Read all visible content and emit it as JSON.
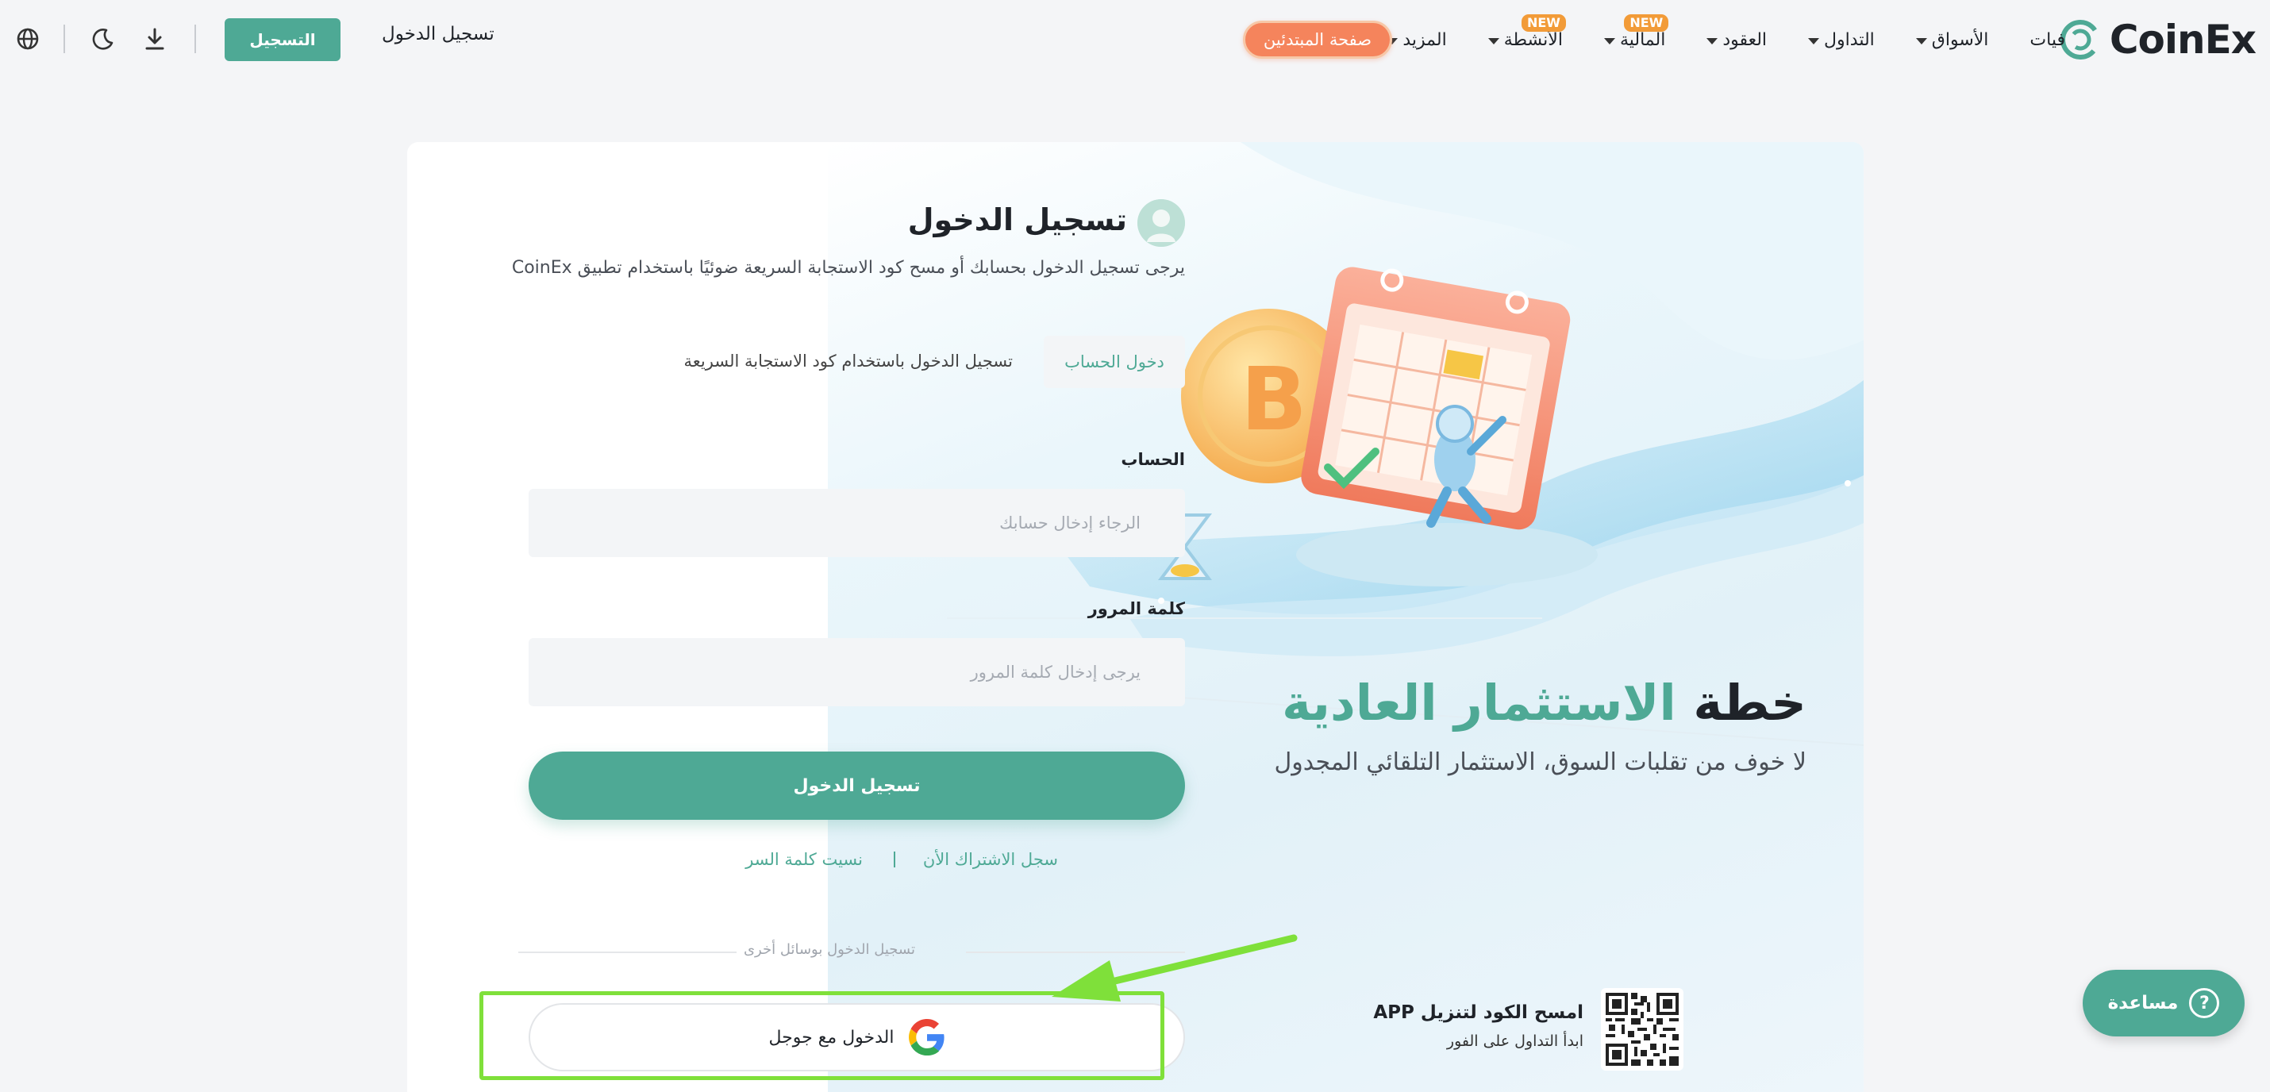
{
  "brand": {
    "name": "CoinEx",
    "color": "#4ea995"
  },
  "nav": {
    "items": [
      {
        "label": "فيات",
        "caret": false,
        "badge": ""
      },
      {
        "label": "الأسواق",
        "caret": true,
        "badge": ""
      },
      {
        "label": "التداول",
        "caret": true,
        "badge": ""
      },
      {
        "label": "العقود",
        "caret": true,
        "badge": ""
      },
      {
        "label": "المالية",
        "caret": true,
        "badge": "NEW"
      },
      {
        "label": "الأنشطة",
        "caret": true,
        "badge": "NEW"
      },
      {
        "label": "المزيد",
        "caret": true,
        "badge": ""
      }
    ],
    "beginner_label": "صفحة المبتدئين",
    "login_label": "تسجيل الدخول",
    "register_label": "التسجيل",
    "icons": [
      "download-icon",
      "moon-icon",
      "globe-icon"
    ]
  },
  "login": {
    "title": "تسجيل الدخول",
    "subtitle": "يرجى تسجيل الدخول بحسابك أو مسح كود الاستجابة السريعة ضوئيًا باستخدام تطبيق CoinEx",
    "tab_account": "دخول الحساب",
    "tab_qr": "تسجيل الدخول باستخدام كود الاستجابة السريعة",
    "account_label": "الحساب",
    "account_placeholder": "الرجاء إدخال حسابك",
    "account_value": "",
    "password_label": "كلمة المرور",
    "password_placeholder": "يرجى إدخال كلمة المرور",
    "password_value": "",
    "submit_label": "تسجيل الدخول",
    "signup_link": "سجل الاشتراك الأن",
    "forgot_link": "نسيت كلمة السر",
    "other_methods": "تسجيل الدخول بوسائل أخرى",
    "google_label": "الدخول مع جوجل"
  },
  "promo": {
    "title_part1": "خطة",
    "title_part2": "الاستثمار العادية",
    "subtitle": "لا خوف من تقلبات السوق، الاستثمار التلقائي المجدول",
    "qr_title": "امسح الكود لتنزيل APP",
    "qr_subtitle": "ابدأ التداول على الفور"
  },
  "help": {
    "label": "مساعدة",
    "icon": "?"
  },
  "colors": {
    "accent": "#4ea995",
    "orange": "#f5845c",
    "badge": "#f29b38",
    "highlight": "#7fe03a"
  }
}
